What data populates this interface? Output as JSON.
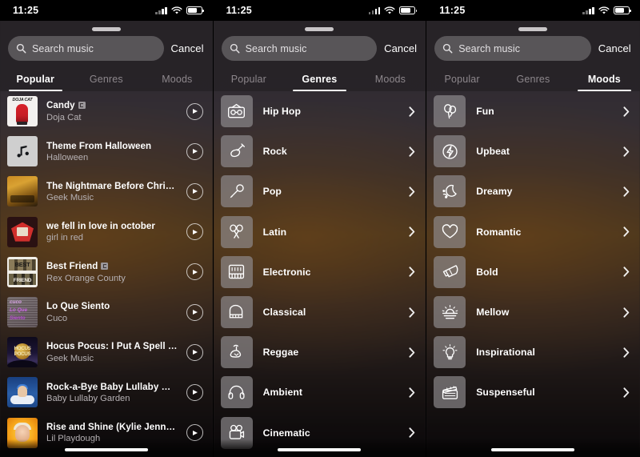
{
  "status_bar": {
    "time": "11:25",
    "cellular_icon": "cellular-bars-icon",
    "wifi_icon": "wifi-icon",
    "battery_icon": "battery-icon"
  },
  "search": {
    "placeholder": "Search music",
    "value": "",
    "icon": "search-icon",
    "cancel_label": "Cancel"
  },
  "tabs": [
    {
      "id": "popular",
      "label": "Popular"
    },
    {
      "id": "genres",
      "label": "Genres"
    },
    {
      "id": "moods",
      "label": "Moods"
    }
  ],
  "panels": [
    {
      "id": "panel-popular",
      "active_tab": "popular"
    },
    {
      "id": "panel-genres",
      "active_tab": "genres"
    },
    {
      "id": "panel-moods",
      "active_tab": "moods"
    }
  ],
  "popular": {
    "songs": [
      {
        "title": "Candy",
        "artist": "Doja Cat",
        "explicit": true,
        "art": "art-doja",
        "art_text": "DOJA CAT",
        "play": "play-icon"
      },
      {
        "title": "Theme From Halloween",
        "artist": "Halloween",
        "explicit": false,
        "art": "art-note",
        "art_text": "",
        "play": "play-icon"
      },
      {
        "title": "The Nightmare Before Christmas…",
        "artist": "Geek Music",
        "explicit": false,
        "art": "art-nbc",
        "art_text": "",
        "play": "play-icon"
      },
      {
        "title": "we fell in love in october",
        "artist": "girl in red",
        "explicit": false,
        "art": "art-wfl",
        "art_text": "",
        "play": "play-icon"
      },
      {
        "title": "Best Friend",
        "artist": "Rex Orange County",
        "explicit": true,
        "art": "art-bf",
        "art_text": "BEST",
        "art_text2": "FRIEND",
        "play": "play-icon"
      },
      {
        "title": "Lo Que Siento",
        "artist": "Cuco",
        "explicit": false,
        "art": "art-lqs",
        "art_text": "cuco",
        "art_text2": "Lo Que",
        "art_text3": "Siento",
        "play": "play-icon"
      },
      {
        "title": "Hocus Pocus: I Put A Spell On You",
        "artist": "Geek Music",
        "explicit": false,
        "art": "art-hp",
        "art_text": "HOCUS POCUS",
        "play": "play-icon"
      },
      {
        "title": "Rock-a-Bye Baby Lullaby Nurser…",
        "artist": "Baby Lullaby Garden",
        "explicit": false,
        "art": "art-rbb",
        "art_text": "",
        "play": "play-icon"
      },
      {
        "title": "Rise and Shine (Kylie Jenner)",
        "artist": "Lil Playdough",
        "explicit": false,
        "art": "art-ras",
        "art_text": "",
        "play": "play-icon"
      }
    ]
  },
  "genres": {
    "items": [
      {
        "label": "Hip Hop",
        "icon": "boombox-icon",
        "chevron": "chevron-right-icon"
      },
      {
        "label": "Rock",
        "icon": "electric-guitar-icon",
        "chevron": "chevron-right-icon"
      },
      {
        "label": "Pop",
        "icon": "microphone-icon",
        "chevron": "chevron-right-icon"
      },
      {
        "label": "Latin",
        "icon": "maracas-icon",
        "chevron": "chevron-right-icon"
      },
      {
        "label": "Electronic",
        "icon": "synthesizer-icon",
        "chevron": "chevron-right-icon"
      },
      {
        "label": "Classical",
        "icon": "grand-piano-icon",
        "chevron": "chevron-right-icon"
      },
      {
        "label": "Reggae",
        "icon": "palm-tree-icon",
        "chevron": "chevron-right-icon"
      },
      {
        "label": "Ambient",
        "icon": "headphones-icon",
        "chevron": "chevron-right-icon"
      },
      {
        "label": "Cinematic",
        "icon": "film-camera-icon",
        "chevron": "chevron-right-icon"
      }
    ]
  },
  "moods": {
    "items": [
      {
        "label": "Fun",
        "icon": "balloons-icon",
        "chevron": "chevron-right-icon"
      },
      {
        "label": "Upbeat",
        "icon": "lightning-bolt-icon",
        "chevron": "chevron-right-icon"
      },
      {
        "label": "Dreamy",
        "icon": "moon-cloud-icon",
        "chevron": "chevron-right-icon"
      },
      {
        "label": "Romantic",
        "icon": "heart-icon",
        "chevron": "chevron-right-icon"
      },
      {
        "label": "Bold",
        "icon": "megaphone-icon",
        "chevron": "chevron-right-icon"
      },
      {
        "label": "Mellow",
        "icon": "sunset-icon",
        "chevron": "chevron-right-icon"
      },
      {
        "label": "Inspirational",
        "icon": "lightbulb-icon",
        "chevron": "chevron-right-icon"
      },
      {
        "label": "Suspenseful",
        "icon": "clapperboard-icon",
        "chevron": "chevron-right-icon"
      }
    ]
  },
  "colors": {
    "sheet_bg": "#2f2b2e",
    "accent_warm": "#7c5c2c",
    "tab_active": "#ffffff",
    "tab_inactive": "#8d878c",
    "tile_bg": "#928e92"
  },
  "misc": {
    "grabber": "sheet-grabber",
    "home_indicator": "home-indicator"
  }
}
